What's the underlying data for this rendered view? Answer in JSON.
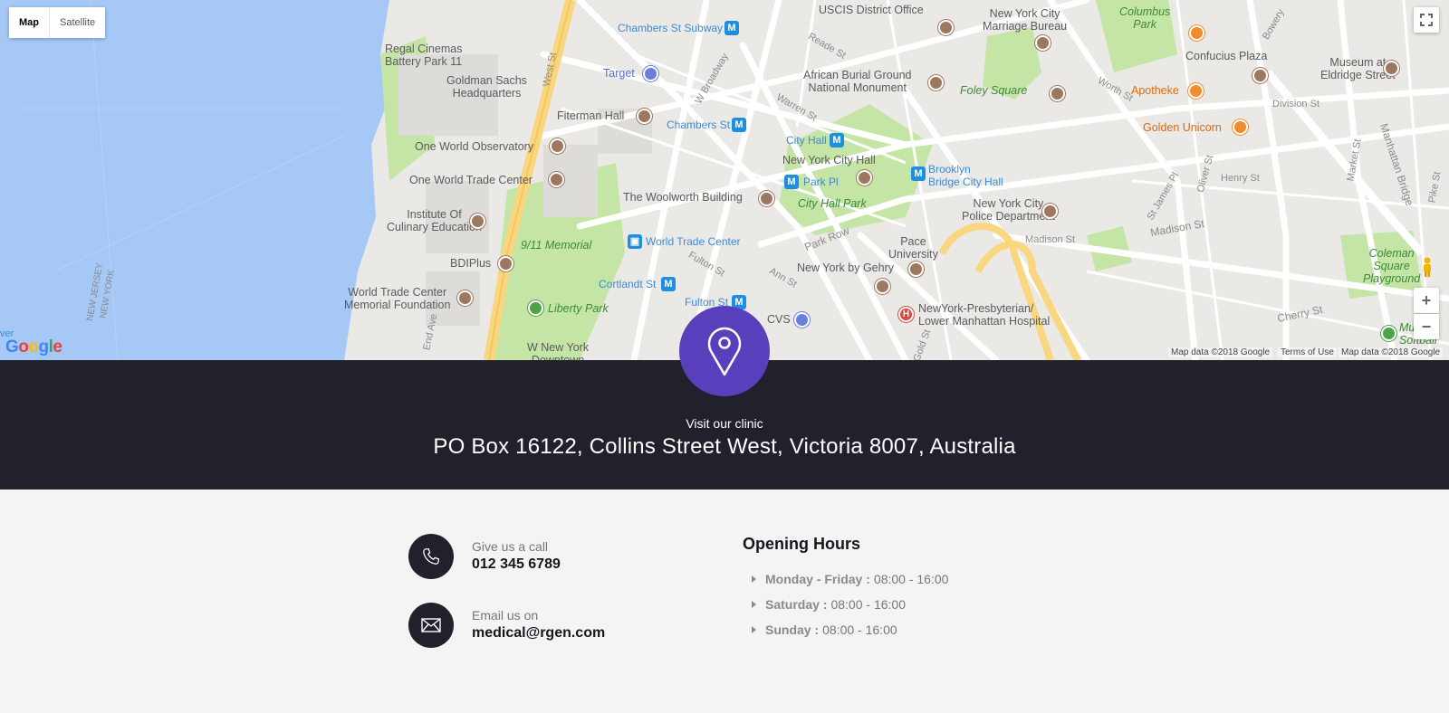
{
  "map": {
    "type_controls": {
      "map_label": "Map",
      "satellite_label": "Satellite"
    },
    "google_logo": "Google",
    "attribution": {
      "map_data_left": "Map data ©2018 Google",
      "terms": "Terms of Use",
      "map_data_right": "Map data ©2018 Google"
    },
    "zoom_in": "+",
    "zoom_out": "−",
    "labels": {
      "regal": "Regal Cinemas\nBattery Park 11",
      "goldman": "Goldman Sachs\nHeadquarters",
      "west_st": "West St",
      "chambers_subway": "Chambers St Subway",
      "target": "Target",
      "w_broadway": "W Broadway",
      "fiterman": "Fiterman Hall",
      "chambers_st": "Chambers St",
      "one_world_obs": "One World Observatory",
      "one_wtc": "One World Trade Center",
      "institute": "Institute Of\nCulinary Education",
      "nine_eleven": "9/11 Memorial",
      "bdiplus": "BDIPlus",
      "wtc_memorial": "World Trade Center\nMemorial Foundation",
      "liberty_park": "Liberty Park",
      "w_new_york": "W New York\nDowntown",
      "end_ave": "End Ave",
      "nj_ny": "NEW JERSEY\nNEW YORK",
      "uscis": "USCIS District Office",
      "nyc_marriage": "New York City\nMarriage Bureau",
      "reade_st": "Reade St",
      "african_burial": "African Burial Ground\nNational Monument",
      "foley": "Foley Square",
      "warren_st": "Warren St",
      "city_hall_metro": "City Hall",
      "nyc_hall": "New York City Hall",
      "park_pl": "Park Pl",
      "woolworth": "The Woolworth Building",
      "city_hall_park": "City Hall Park",
      "brooklyn_bridge": "Brooklyn\nBridge City Hall",
      "wtc_metro": "World Trade Center",
      "fulton_st": "Fulton St",
      "cortlandt": "Cortlandt St",
      "fulton_metro": "Fulton St",
      "ann_st": "Ann St",
      "park_row": "Park Row",
      "cvs": "CVS",
      "nyc_police": "New York City\nPolice Department",
      "pace": "Pace\nUniversity",
      "gehry": "New York by Gehry",
      "presbyterian": "NewYork-Presbyterian/\nLower Manhattan Hospital",
      "gold_st": "Gold St",
      "columbus_park": "Columbus\nPark",
      "confucius": "Confucius Plaza",
      "museum_eldridge": "Museum at\nEldridge Street",
      "bowery": "Bowery",
      "worth_st": "Worth St",
      "apotheke": "Apotheke",
      "division_st": "Division St",
      "golden_unicorn": "Golden Unicorn",
      "oliver_st": "Oliver St",
      "henry_st": "Henry St",
      "market_st": "Market St",
      "manhattan_bridge": "Manhattan Bridge",
      "pike_st": "Pike St",
      "st_james": "St James Pl",
      "madison_st": "Madison St",
      "madison_st2": "Madison St",
      "coleman": "Coleman\nSquare\nPlayground",
      "cherry_st": "Cherry St",
      "softball": "Mu\nSoftball",
      "river": "ver"
    }
  },
  "band": {
    "visit_label": "Visit our clinic",
    "address": "PO Box 16122, Collins Street West, Victoria 8007, Australia",
    "accent_color": "#5a3fbd",
    "band_color": "#20212a"
  },
  "contact": {
    "phone": {
      "label": "Give us a call",
      "value": "012 345 6789",
      "icon": "phone-icon"
    },
    "email": {
      "label": "Email us on",
      "value": "medical@rgen.com",
      "icon": "envelope-icon"
    },
    "hours": {
      "title": "Opening Hours",
      "items": [
        {
          "day": "Monday - Friday :",
          "time": "08:00 - 16:00"
        },
        {
          "day": "Saturday :",
          "time": "08:00 - 16:00"
        },
        {
          "day": "Sunday :",
          "time": "08:00 - 16:00"
        }
      ]
    }
  }
}
